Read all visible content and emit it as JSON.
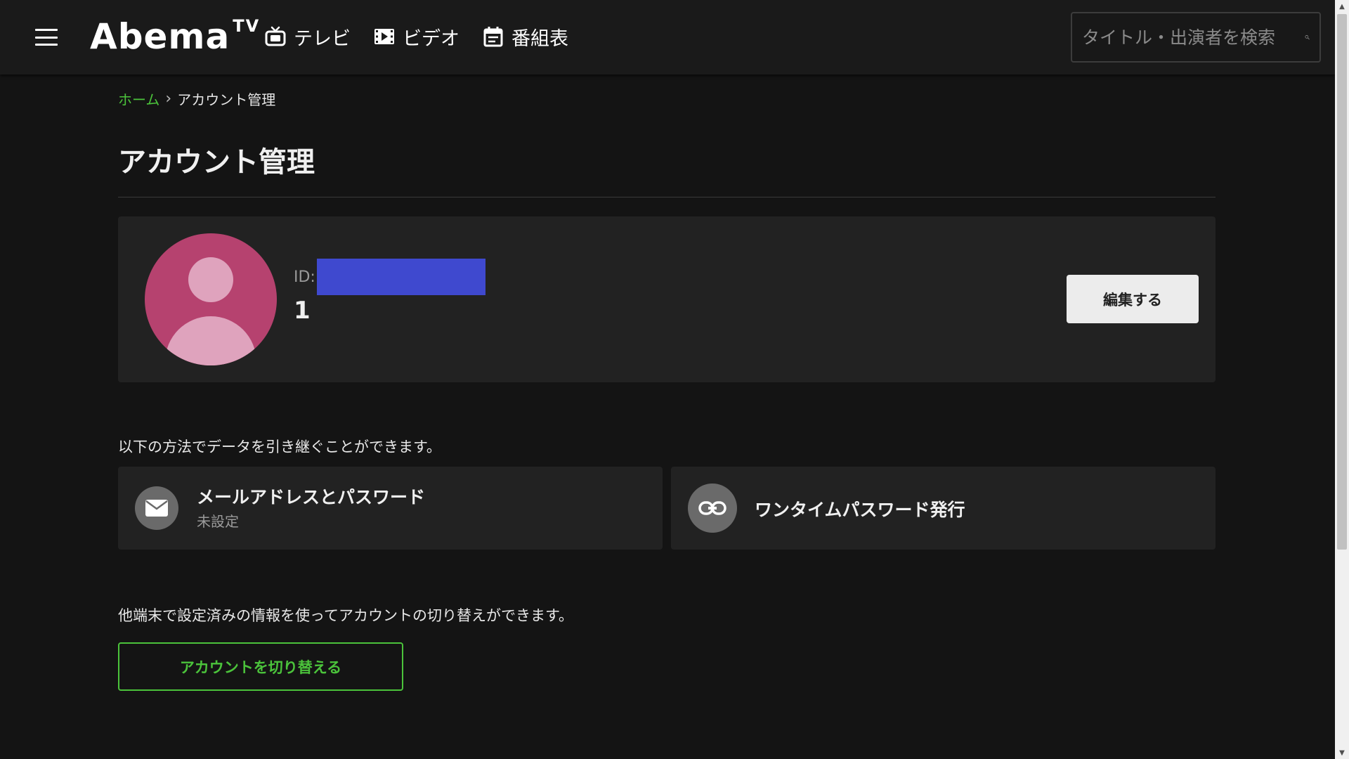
{
  "header": {
    "logo_main": "Abema",
    "logo_tv": "TV",
    "nav": [
      {
        "label": "テレビ",
        "icon": "tv-icon"
      },
      {
        "label": "ビデオ",
        "icon": "film-icon"
      },
      {
        "label": "番組表",
        "icon": "calendar-icon"
      }
    ],
    "search_placeholder": "タイトル・出演者を検索"
  },
  "breadcrumb": {
    "home": "ホーム",
    "separator": "›",
    "current": "アカウント管理"
  },
  "page_title": "アカウント管理",
  "profile": {
    "id_label": "ID:",
    "name": "1",
    "edit_label": "編集する",
    "avatar_color": "#b6426f"
  },
  "transfer": {
    "description": "以下の方法でデータを引き継ぐことができます。",
    "options": [
      {
        "title": "メールアドレスとパスワード",
        "subtitle": "未設定",
        "icon": "mail-icon"
      },
      {
        "title": "ワンタイムパスワード発行",
        "icon": "link-icon"
      }
    ]
  },
  "switch": {
    "description": "他端末で設定済みの情報を使ってアカウントの切り替えができます。",
    "button_label": "アカウントを切り替える"
  },
  "colors": {
    "accent": "#4bc33b",
    "background": "#141414",
    "card": "#222222",
    "redaction": "#3f49cf"
  }
}
